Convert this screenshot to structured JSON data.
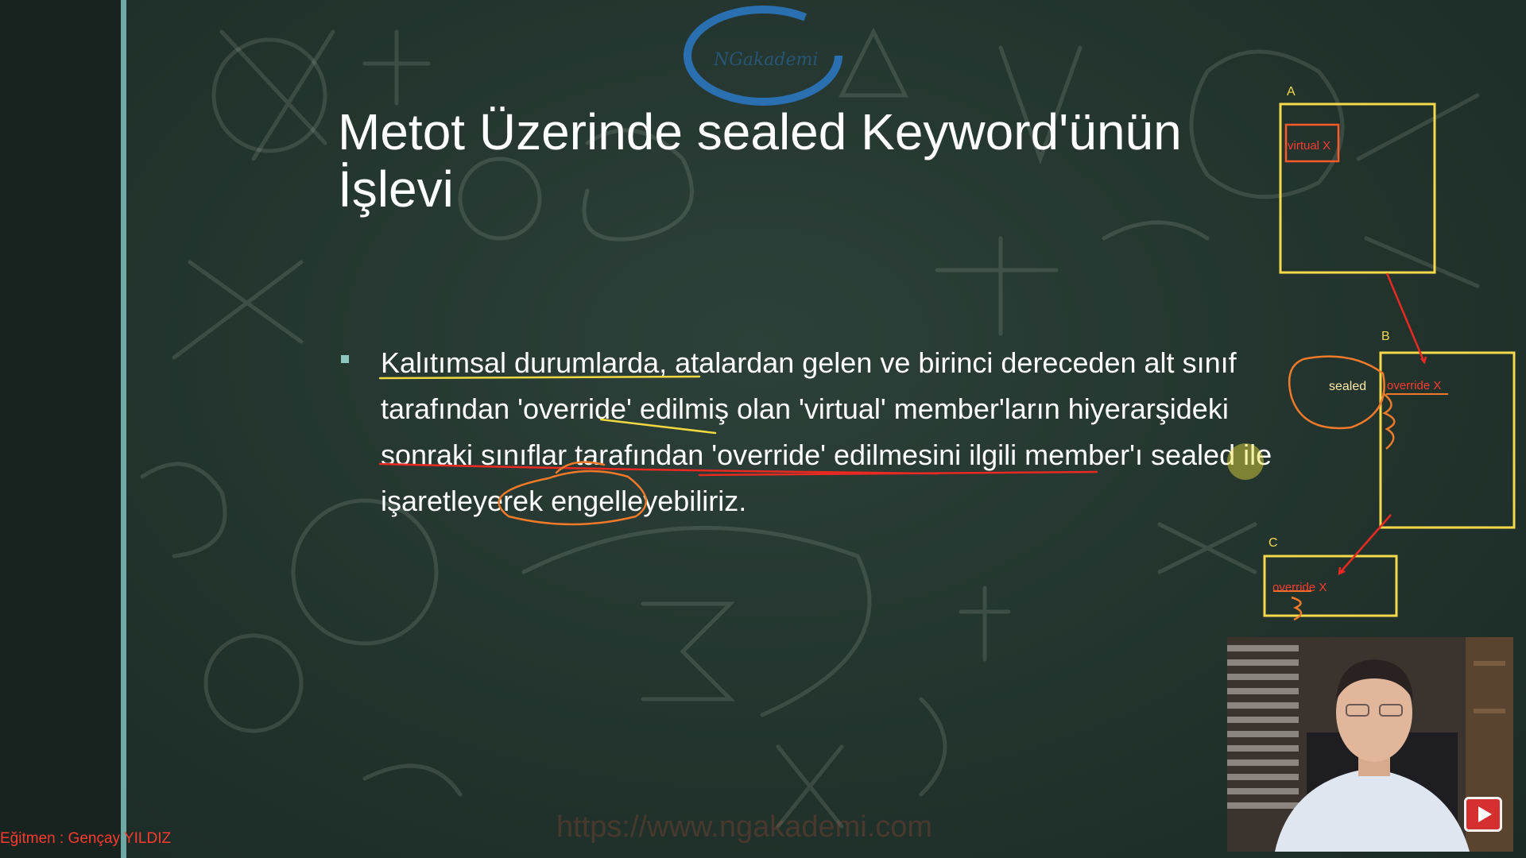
{
  "slide": {
    "title": "Metot Üzerinde sealed Keyword'ünün İşlevi",
    "bullet_text": "Kalıtımsal durumlarda, atalardan gelen ve birinci dereceden alt sınıf tarafından 'override' edilmiş olan 'virtual' member'ların hiyerarşideki sonraki sınıflar tarafından 'override' edilmesini ilgili member'ı sealed ile işaretleyerek engelleyebiliriz."
  },
  "diagram": {
    "box_a_label": "A",
    "box_a_member": "virtual X",
    "box_b_label": "B",
    "box_b_member": "override X",
    "sealed_note": "sealed",
    "box_c_label": "C",
    "box_c_member": "override X"
  },
  "footer": {
    "instructor": "Eğitmen : Gençay YILDIZ",
    "watermark_url": "https://www.ngakademi.com"
  },
  "logo": {
    "text": "NGakademi"
  },
  "colors": {
    "chalkboard": "#24362f",
    "divider": "#6fa9a6",
    "bullet": "#8cc6bd",
    "diagram_box": "#f5d94a",
    "diagram_text": "#ff3b2f",
    "annotation_orange": "#f07a2a",
    "annotation_yellow": "#f0d840",
    "annotation_red": "#e82a22",
    "logo_blue": "#2a6fb0"
  },
  "icons": {
    "play_button": "youtube-play-icon"
  }
}
